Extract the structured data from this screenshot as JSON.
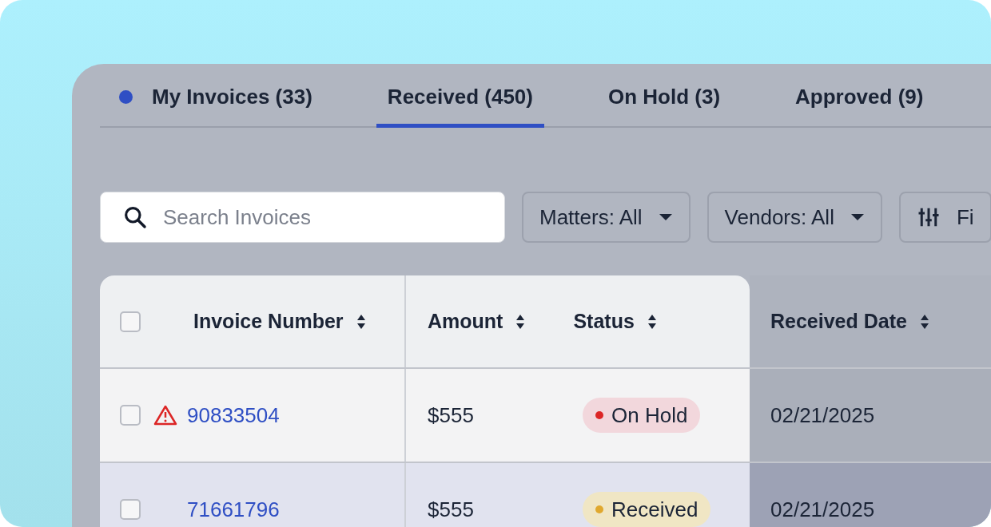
{
  "tabs": [
    {
      "label": "My Invoices (33)",
      "selected": false,
      "unread": true
    },
    {
      "label": "Received (450)",
      "selected": true,
      "unread": false
    },
    {
      "label": "On Hold (3)",
      "selected": false,
      "unread": false
    },
    {
      "label": "Approved (9)",
      "selected": false,
      "unread": false
    }
  ],
  "search": {
    "placeholder": "Search Invoices"
  },
  "filters": [
    {
      "kind": "dropdown",
      "label": "Matters: All"
    },
    {
      "kind": "dropdown",
      "label": "Vendors: All"
    },
    {
      "kind": "filter",
      "label": "Fi"
    }
  ],
  "table": {
    "select_all": {
      "checked": false
    },
    "columns": [
      "Invoice Number",
      "Amount",
      "Status",
      "Received Date"
    ],
    "rows": [
      {
        "checked": false,
        "hovered": false,
        "warning": true,
        "invoice": "90833504",
        "amount": "$555",
        "status": {
          "kind": "on_hold",
          "label": "On Hold",
          "color": "#dc2626"
        },
        "date": "02/21/2025"
      },
      {
        "checked": false,
        "hovered": true,
        "warning": false,
        "invoice": "71661796",
        "amount": "$555",
        "status": {
          "kind": "received",
          "label": "Received",
          "color": "#e0a82e"
        },
        "date": "02/21/2025"
      }
    ]
  }
}
